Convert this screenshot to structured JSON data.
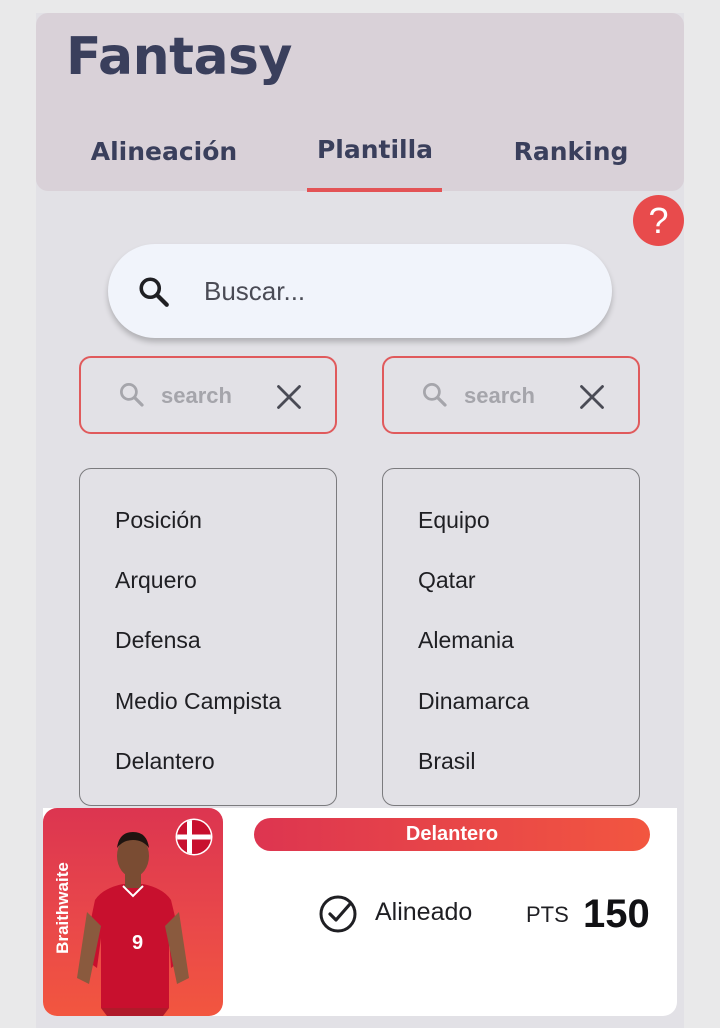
{
  "app": {
    "title": "Fantasy"
  },
  "tabs": [
    {
      "label": "Alineación"
    },
    {
      "label": "Plantilla",
      "active": true
    },
    {
      "label": "Ranking"
    }
  ],
  "help": {
    "label": "?"
  },
  "search": {
    "placeholder": "Buscar...",
    "icon": "search-icon"
  },
  "filters": {
    "position": {
      "search_placeholder": "search",
      "options": [
        "Posición",
        "Arquero",
        "Defensa",
        "Medio Campista",
        "Delantero"
      ]
    },
    "team": {
      "search_placeholder": "search",
      "options": [
        "Equipo",
        "Qatar",
        "Alemania",
        "Dinamarca",
        "Brasil"
      ]
    }
  },
  "player_card": {
    "name": "Braithwaite",
    "shirt_number": "9",
    "position": "Delantero",
    "status": "Alineado",
    "points_label": "PTS",
    "points": "150",
    "flag": "denmark-flag"
  },
  "colors": {
    "accent": "#e35356",
    "header_bg": "#d9d1d8",
    "title": "#3a3f5c",
    "card_gradient_start": "#dc3550",
    "card_gradient_end": "#f25640"
  }
}
